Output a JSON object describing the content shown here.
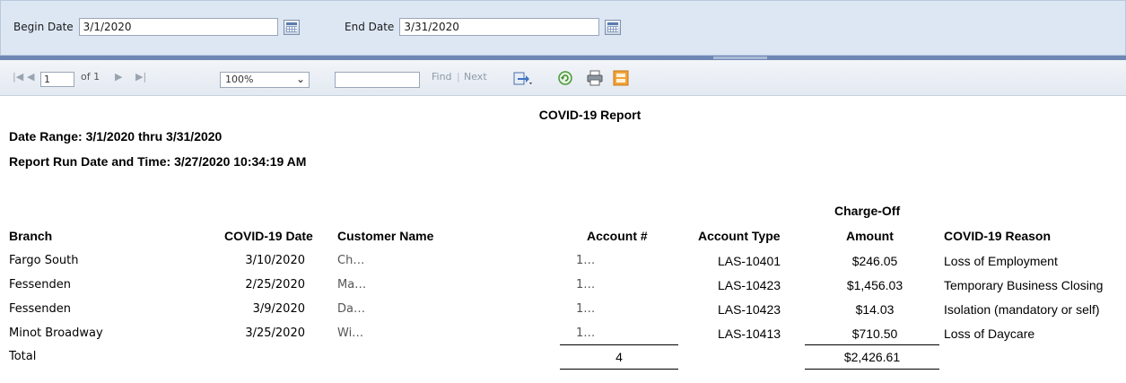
{
  "params": {
    "begin_label": "Begin Date",
    "begin_value": "3/1/2020",
    "end_label": "End Date",
    "end_value": "3/31/2020"
  },
  "toolbar": {
    "first_page_icon": "first-page-icon",
    "prev_page_icon": "prev-page-icon",
    "page_value": "1",
    "of_label": "of 1",
    "next_page_icon": "next-page-icon",
    "last_page_icon": "last-page-icon",
    "zoom_value": "100%",
    "find_label": "Find",
    "separator": "|",
    "next_label": "Next"
  },
  "report": {
    "title": "COVID-19 Report",
    "date_range": "Date Range: 3/1/2020 thru 3/31/2020",
    "run_date": "Report Run Date and Time: 3/27/2020 10:34:19 AM",
    "headers": {
      "branch": "Branch",
      "covid_date": "COVID-19 Date",
      "customer": "Customer Name",
      "account": "Account #",
      "account_type": "Account Type",
      "chargeoff_line1": "Charge-Off",
      "chargeoff_line2": "Amount",
      "reason": "COVID-19 Reason"
    },
    "rows": [
      {
        "branch": "Fargo South",
        "date": "3/10/2020",
        "customer": "Ch…",
        "account": "1…",
        "type": "LAS-10401",
        "amount": "$246.05",
        "reason": "Loss of Employment"
      },
      {
        "branch": "Fessenden",
        "date": "2/25/2020",
        "customer": "Ma…",
        "account": "1…",
        "type": "LAS-10423",
        "amount": "$1,456.03",
        "reason": "Temporary Business Closing"
      },
      {
        "branch": "Fessenden",
        "date": "3/9/2020",
        "customer": "Da…",
        "account": "1…",
        "type": "LAS-10423",
        "amount": "$14.03",
        "reason": "Isolation (mandatory or self)"
      },
      {
        "branch": "Minot Broadway",
        "date": "3/25/2020",
        "customer": "Wi…",
        "account": "1…",
        "type": "LAS-10413",
        "amount": "$710.50",
        "reason": "Loss of Daycare"
      }
    ],
    "total_label": "Total",
    "total_count": "4",
    "total_amount": "$2,426.61"
  }
}
